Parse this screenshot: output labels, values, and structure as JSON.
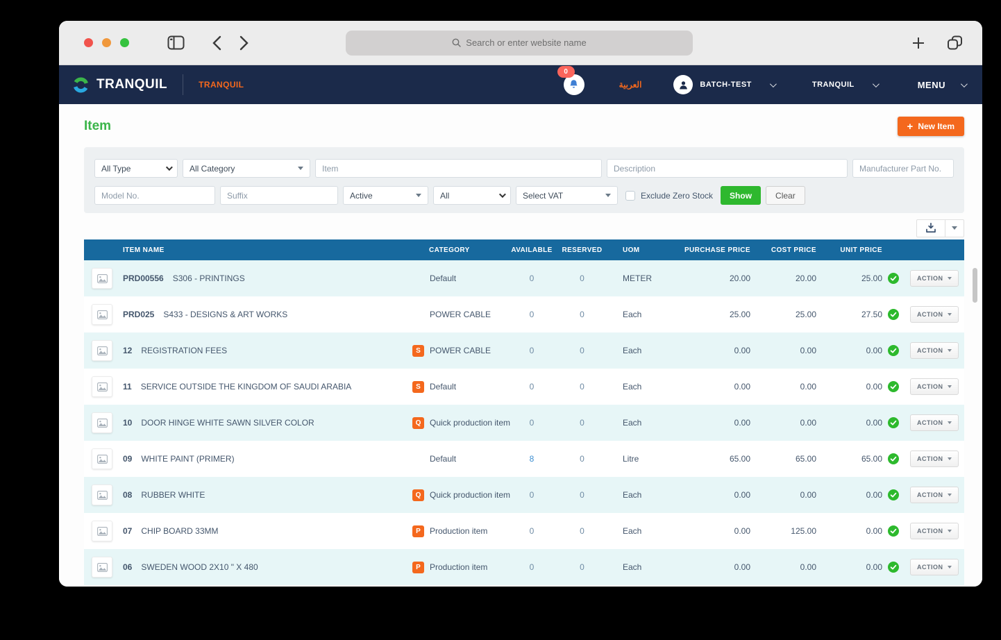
{
  "browser": {
    "address_placeholder": "Search or enter website name"
  },
  "navbar": {
    "brand": "TRANQUIL",
    "sub_brand": "TRANQUIL",
    "notification_count": "0",
    "language": "العربية",
    "user": "BATCH-TEST",
    "company": "TRANQUIL",
    "menu": "MENU"
  },
  "page": {
    "title": "Item",
    "new_item_label": "New Item",
    "new_item_plus": "+"
  },
  "filters": {
    "type_select": "All Type",
    "category_select": "All Category",
    "item_placeholder": "Item",
    "description_placeholder": "Description",
    "mpn_placeholder": "Manufacturer Part No.",
    "model_placeholder": "Model No.",
    "suffix_placeholder": "Suffix",
    "status_select": "Active",
    "stock_select": "All",
    "vat_select": "Select VAT",
    "exclude_zero_stock_label": "Exclude Zero Stock",
    "show_label": "Show",
    "clear_label": "Clear"
  },
  "icons": {
    "export": "download-icon",
    "status": "check-circle-icon",
    "notification": "bell-icon",
    "user": "person-icon",
    "thumbnail": "image-placeholder-icon"
  },
  "table": {
    "headers": [
      "ITEM NAME",
      "CATEGORY",
      "AVAILABLE",
      "RESERVED",
      "UOM",
      "PURCHASE PRICE",
      "COST PRICE",
      "UNIT PRICE"
    ],
    "action_label": "ACTION",
    "rows": [
      {
        "code": "PRD00556",
        "name": "S306 - PRINTINGS",
        "badge": "",
        "category": "Default",
        "available": "0",
        "reserved": "0",
        "uom": "METER",
        "purchase": "20.00",
        "cost": "20.00",
        "unit": "25.00"
      },
      {
        "code": "PRD025",
        "name": "S433 - DESIGNS & ART WORKS",
        "badge": "",
        "category": "POWER CABLE",
        "available": "0",
        "reserved": "0",
        "uom": "Each",
        "purchase": "25.00",
        "cost": "25.00",
        "unit": "27.50"
      },
      {
        "code": "12",
        "name": "REGISTRATION FEES",
        "badge": "S",
        "category": "POWER CABLE",
        "available": "0",
        "reserved": "0",
        "uom": "Each",
        "purchase": "0.00",
        "cost": "0.00",
        "unit": "0.00"
      },
      {
        "code": "11",
        "name": "SERVICE OUTSIDE THE KINGDOM OF SAUDI ARABIA",
        "badge": "S",
        "category": "Default",
        "available": "0",
        "reserved": "0",
        "uom": "Each",
        "purchase": "0.00",
        "cost": "0.00",
        "unit": "0.00"
      },
      {
        "code": "10",
        "name": "DOOR HINGE WHITE SAWN SILVER COLOR",
        "badge": "Q",
        "category": "Quick production item",
        "available": "0",
        "reserved": "0",
        "uom": "Each",
        "purchase": "0.00",
        "cost": "0.00",
        "unit": "0.00"
      },
      {
        "code": "09",
        "name": "WHITE PAINT (PRIMER)",
        "badge": "",
        "category": "Default",
        "available": "8",
        "reserved": "0",
        "uom": "Litre",
        "purchase": "65.00",
        "cost": "65.00",
        "unit": "65.00"
      },
      {
        "code": "08",
        "name": "RUBBER WHITE",
        "badge": "Q",
        "category": "Quick production item",
        "available": "0",
        "reserved": "0",
        "uom": "Each",
        "purchase": "0.00",
        "cost": "0.00",
        "unit": "0.00"
      },
      {
        "code": "07",
        "name": "CHIP BOARD 33MM",
        "badge": "P",
        "category": "Production item",
        "available": "0",
        "reserved": "0",
        "uom": "Each",
        "purchase": "0.00",
        "cost": "125.00",
        "unit": "0.00"
      },
      {
        "code": "06",
        "name": "SWEDEN WOOD 2X10 \" X 480",
        "badge": "P",
        "category": "Production item",
        "available": "0",
        "reserved": "0",
        "uom": "Each",
        "purchase": "0.00",
        "cost": "0.00",
        "unit": "0.00"
      }
    ]
  },
  "colors": {
    "navy": "#1b2a4a",
    "orange": "#f4681d",
    "title_green": "#3bb54a",
    "button_green": "#2eb82e",
    "header_teal": "#17699e",
    "row_alt": "#e7f6f7",
    "text": "#44566c",
    "number": "#6f8ba4",
    "number_positive": "#3d8fd1",
    "check_green": "#2db92d",
    "badge_red": "#fb655c"
  }
}
